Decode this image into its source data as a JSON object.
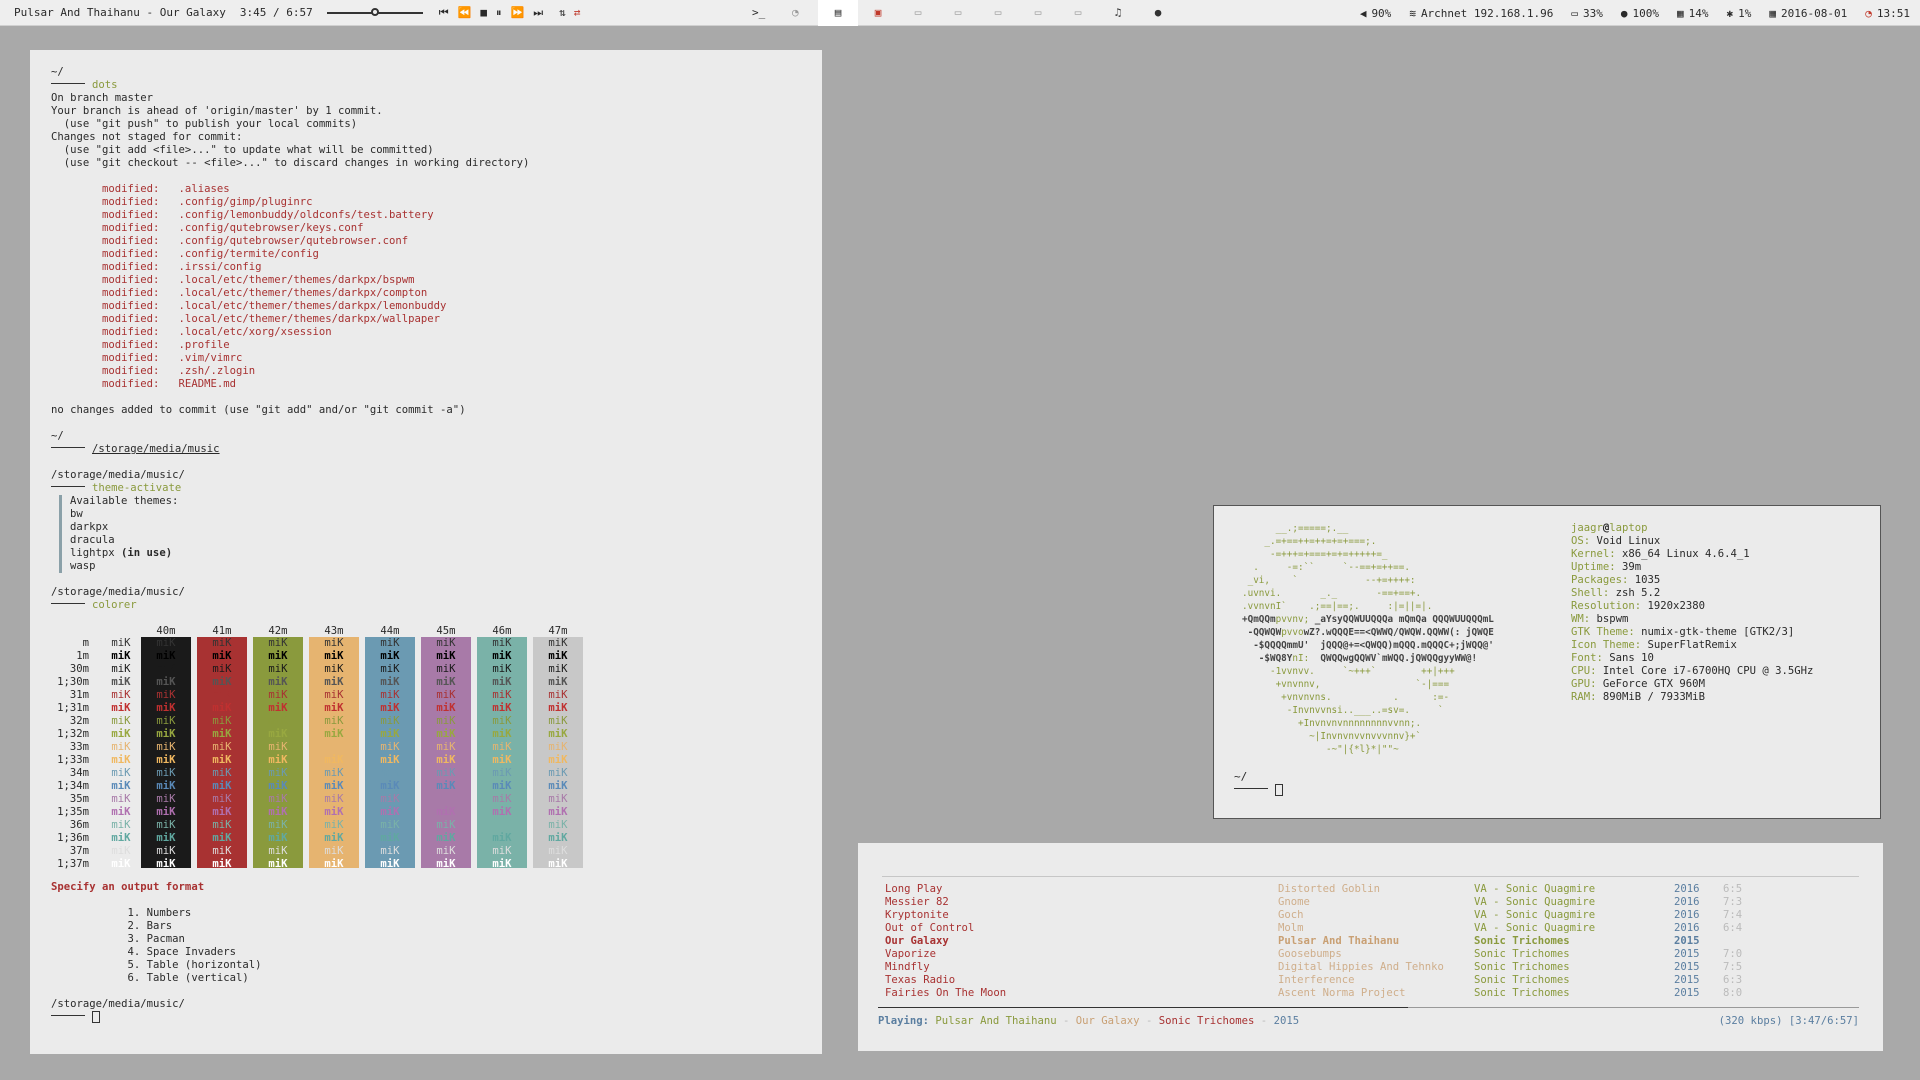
{
  "bar": {
    "track": "Pulsar And Thaihanu - Our Galaxy",
    "time": "3:45 / 6:57",
    "seek_fraction": 0.5,
    "controls": [
      "⏮",
      "⏪",
      "■",
      "⏸",
      "⏩",
      "⏭"
    ],
    "shuffle": "⇅",
    "repeat": "⇄",
    "terminal_icon": "terminal-icon",
    "workspaces": [
      "▤",
      "▣",
      "▭",
      "▭",
      "▭",
      "▭",
      "▭",
      "♫",
      "●"
    ],
    "status": [
      {
        "icon": "volume-icon",
        "glyph": "◀",
        "text": "90%"
      },
      {
        "icon": "wifi-icon",
        "glyph": "≋",
        "text": "Archnet 192.168.1.96"
      },
      {
        "icon": "battery-icon",
        "glyph": "▭",
        "text": "33%"
      },
      {
        "icon": "brightness-icon",
        "glyph": "●",
        "text": "100%"
      },
      {
        "icon": "memory-icon",
        "glyph": "▦",
        "text": "14%"
      },
      {
        "icon": "cpu-icon",
        "glyph": "✱",
        "text": "1%"
      },
      {
        "icon": "calendar-icon",
        "glyph": "▦",
        "text": "2016-08-01"
      },
      {
        "icon": "clock-icon",
        "glyph": "◔",
        "text": "13:51"
      }
    ]
  },
  "term1": {
    "home": "~/",
    "cmd_dots": "dots",
    "git_lines": [
      "On branch master",
      "Your branch is ahead of 'origin/master' by 1 commit.",
      "  (use \"git push\" to publish your local commits)",
      "Changes not staged for commit:",
      "  (use \"git add <file>...\" to update what will be committed)",
      "  (use \"git checkout -- <file>...\" to discard changes in working directory)"
    ],
    "modified_label": "modified:",
    "modified": [
      ".aliases",
      ".config/gimp/pluginrc",
      ".config/lemonbuddy/oldconfs/test.battery",
      ".config/qutebrowser/keys.conf",
      ".config/qutebrowser/qutebrowser.conf",
      ".config/termite/config",
      ".irssi/config",
      ".local/etc/themer/themes/darkpx/bspwm",
      ".local/etc/themer/themes/darkpx/compton",
      ".local/etc/themer/themes/darkpx/lemonbuddy",
      ".local/etc/themer/themes/darkpx/wallpaper",
      ".local/etc/xorg/xsession",
      ".profile",
      ".vim/vimrc",
      ".zsh/.zlogin",
      "README.md"
    ],
    "no_changes": "no changes added to commit (use \"git add\" and/or \"git commit -a\")",
    "home2": "~/",
    "cd_target": "/storage/media/music",
    "music_dir": "/storage/media/music/",
    "cmd_theme": "theme-activate",
    "themes_title": "Available themes:",
    "themes": [
      "bw",
      "darkpx",
      "dracula",
      "lightpx",
      "wasp"
    ],
    "in_use": "(in use)",
    "music_dir2": "/storage/media/music/",
    "cmd_colorer": "colorer",
    "grid_headers": [
      "40m",
      "41m",
      "42m",
      "43m",
      "44m",
      "45m",
      "46m",
      "47m"
    ],
    "grid_rows": [
      "m",
      "1m",
      "30m",
      "1;30m",
      "31m",
      "1;31m",
      "32m",
      "1;32m",
      "33m",
      "1;33m",
      "34m",
      "1;34m",
      "35m",
      "1;35m",
      "36m",
      "1;36m",
      "37m",
      "1;37m"
    ],
    "sample": "miK",
    "specify": "Specify an output format",
    "formats": [
      "1. Numbers",
      "2. Bars",
      "3. Pacman",
      "4. Space Invaders",
      "5. Table (horizontal)",
      "6. Table (vertical)"
    ],
    "music_dir3": "/storage/media/music/"
  },
  "term2": {
    "user": "jaagr",
    "at": "@",
    "host": "laptop",
    "info": [
      {
        "k": "OS:",
        "v": "Void Linux"
      },
      {
        "k": "Kernel:",
        "v": "x86_64 Linux 4.6.4_1"
      },
      {
        "k": "Uptime:",
        "v": "39m"
      },
      {
        "k": "Packages:",
        "v": "1035"
      },
      {
        "k": "Shell:",
        "v": "zsh 5.2"
      },
      {
        "k": "Resolution:",
        "v": "1920x2380"
      },
      {
        "k": "WM:",
        "v": "bspwm"
      },
      {
        "k": "GTK Theme:",
        "v": "numix-gtk-theme [GTK2/3]"
      },
      {
        "k": "Icon Theme:",
        "v": "SuperFlatRemix"
      },
      {
        "k": "Font:",
        "v": "Sans 10"
      },
      {
        "k": "CPU:",
        "v": "Intel Core i7-6700HQ CPU @ 3.5GHz"
      },
      {
        "k": "GPU:",
        "v": "GeForce GTX 960M"
      },
      {
        "k": "RAM:",
        "v": "890MiB / 7933MiB"
      }
    ],
    "prompt": "~/"
  },
  "player": {
    "tracks": [
      {
        "title": "Long Play",
        "artist": "Distorted Goblin",
        "album": "VA - Sonic Quagmire",
        "year": "2016",
        "len": "6:5"
      },
      {
        "title": "Messier 82",
        "artist": "Gnome",
        "album": "VA - Sonic Quagmire",
        "year": "2016",
        "len": "7:3"
      },
      {
        "title": "Kryptonite",
        "artist": "Goch",
        "album": "VA - Sonic Quagmire",
        "year": "2016",
        "len": "7:4"
      },
      {
        "title": "Out of Control",
        "artist": "Molm",
        "album": "VA - Sonic Quagmire",
        "year": "2016",
        "len": "6:4"
      },
      {
        "title": "Our Galaxy",
        "artist": "Pulsar And Thaihanu",
        "album": "Sonic Trichomes",
        "year": "2015",
        "len": "",
        "current": true
      },
      {
        "title": "Vaporize",
        "artist": "Goosebumps",
        "album": "Sonic Trichomes",
        "year": "2015",
        "len": "7:0"
      },
      {
        "title": "Mindfly",
        "artist": "Digital Hippies And Tehnko",
        "album": "Sonic Trichomes",
        "year": "2015",
        "len": "7:5"
      },
      {
        "title": "Texas Radio",
        "artist": "Interference",
        "album": "Sonic Trichomes",
        "year": "2015",
        "len": "6:3"
      },
      {
        "title": "Fairies On The Moon",
        "artist": "Ascent Norma Project",
        "album": "Sonic Trichomes",
        "year": "2015",
        "len": "8:0"
      }
    ],
    "progress": 0.54,
    "playing_label": "Playing:",
    "playing_artist": "Pulsar And Thaihanu",
    "playing_title": "Our Galaxy",
    "playing_album": "Sonic Trichomes",
    "playing_year": "2015",
    "sep": "-",
    "bitrate": "(320 kbps) [3:47/6:57]"
  },
  "colors": {
    "bg": "#a9a9a9",
    "term_bg": "#ebebeb",
    "red": "#a83232",
    "olive": "#8a9a3d",
    "tan": "#c9a074",
    "blue": "#5a7ea0"
  }
}
